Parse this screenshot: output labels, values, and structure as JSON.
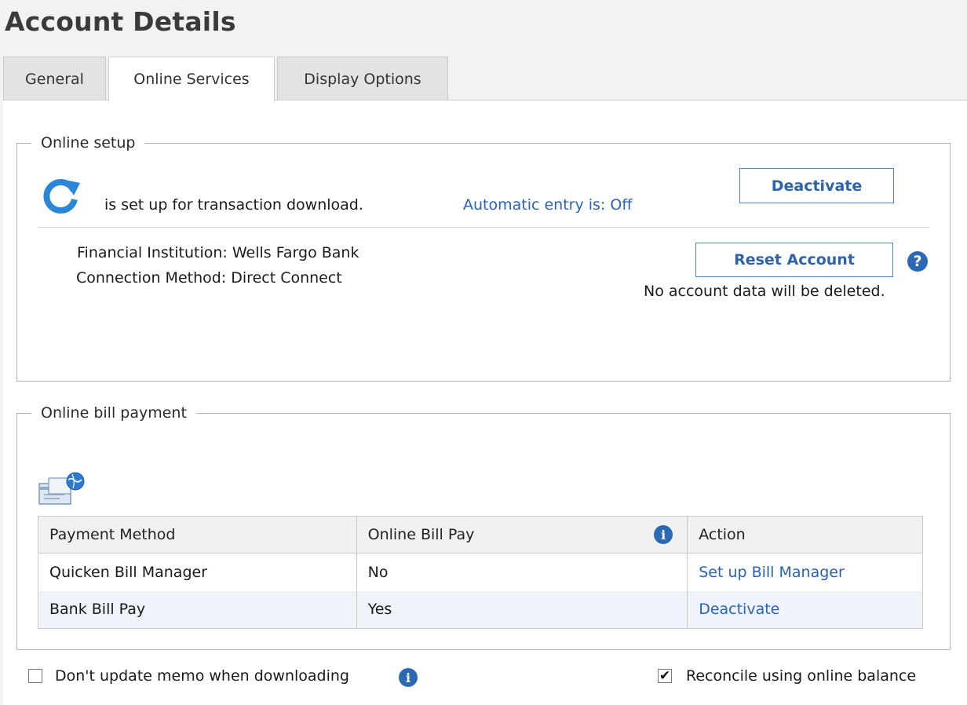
{
  "title": "Account Details",
  "tabs": [
    {
      "label": "General"
    },
    {
      "label": "Online Services"
    },
    {
      "label": "Display Options"
    }
  ],
  "online_setup": {
    "legend": "Online setup",
    "status_text": "is set up for transaction download.",
    "automatic_entry": "Automatic entry is: Off",
    "deactivate_label": "Deactivate",
    "institution_label": "Financial Institution:",
    "institution_value": "Wells Fargo Bank",
    "connection_label": "Connection Method:",
    "connection_value": "Direct Connect",
    "reset_label": "Reset Account",
    "reset_note": "No account data will be deleted.",
    "help_icon": "?"
  },
  "bill_payment": {
    "legend": "Online bill payment",
    "columns": [
      "Payment Method",
      "Online Bill Pay",
      "Action"
    ],
    "rows": [
      {
        "method": "Quicken Bill Manager",
        "online": "No",
        "action": "Set up Bill Manager"
      },
      {
        "method": "Bank Bill Pay",
        "online": "Yes",
        "action": "Deactivate"
      }
    ]
  },
  "options": {
    "memo_label": "Don't update memo when downloading",
    "memo_checked": false,
    "reconcile_label": "Reconcile using online balance",
    "reconcile_checked": true,
    "check_glyph": "✔"
  },
  "colors": {
    "accent": "#2c69b5",
    "link": "#2b62b8"
  },
  "icons": {
    "refresh": "refresh-icon",
    "bill": "bill-payment-icon",
    "info": "info-icon",
    "help": "help-icon"
  }
}
